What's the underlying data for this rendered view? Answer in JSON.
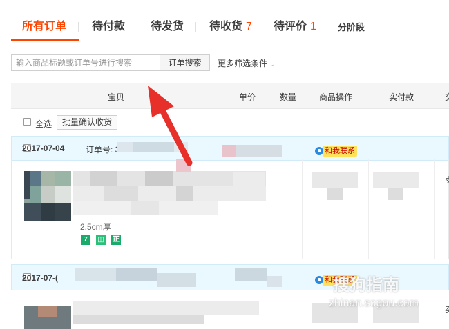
{
  "tabs": [
    {
      "label": "所有订单",
      "count": "",
      "active": true
    },
    {
      "label": "待付款",
      "count": "",
      "active": false
    },
    {
      "label": "待发货",
      "count": "",
      "active": false
    },
    {
      "label": "待收货",
      "count": "7",
      "active": false
    },
    {
      "label": "待评价",
      "count": "1",
      "active": false
    },
    {
      "label": "分阶段",
      "count": "",
      "active": false
    }
  ],
  "search": {
    "placeholder": "输入商品标题或订单号进行搜索",
    "button_label": "订单搜索",
    "more_filters_label": "更多筛选条件",
    "more_filters_icon": "chevron-down-icon"
  },
  "table_header": [
    "宝贝",
    "单价",
    "数量",
    "商品操作",
    "实付款",
    "交"
  ],
  "select_all": {
    "label": "全选",
    "batch_button_label": "批量确认收货"
  },
  "orders": [
    {
      "date": "2017-07-04",
      "order_no_label": "订单号: 3",
      "contact_label": "和我联系",
      "product_note": "2.5cm厚",
      "tags": [
        {
          "text": "7",
          "color": "#1aab6a"
        },
        {
          "text": "◫",
          "color": "#29c07a"
        },
        {
          "text": "正",
          "color": "#1aab6a"
        }
      ],
      "right_edge_char": "卖"
    },
    {
      "date": "2017-07-(",
      "contact_label": "和我联系",
      "right_edge_char": "卖"
    }
  ],
  "watermark": {
    "brand": "搜狗指南",
    "url": "zhinan.sogou.com"
  },
  "colors": {
    "accent": "#ff4400",
    "order_header_bg": "#eaf8ff",
    "contact_badge": "#ffe25a",
    "arrow": "#e8302a"
  }
}
